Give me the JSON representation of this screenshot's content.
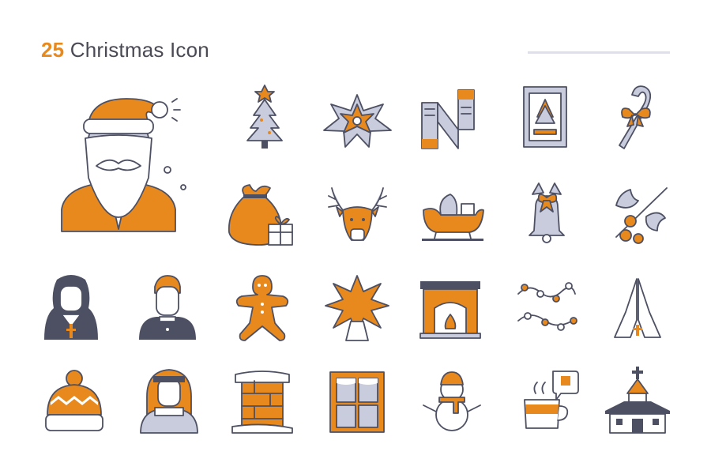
{
  "header": {
    "count": "25",
    "title": "Christmas Icon"
  },
  "icons": [
    "santa-icon",
    "christmas-tree-icon",
    "poinsettia-icon",
    "scarf-icon",
    "christmas-card-icon",
    "candy-cane-icon",
    "gift-sack-icon",
    "reindeer-icon",
    "sleigh-icon",
    "bell-icon",
    "holly-icon",
    "nun-icon",
    "priest-icon",
    "gingerbread-man-icon",
    "star-icon",
    "fireplace-icon",
    "string-lights-icon",
    "praying-hands-icon",
    "winter-hat-icon",
    "girl-in-scarf-icon",
    "chimney-icon",
    "snowy-window-icon",
    "snowman-icon",
    "hot-cocoa-icon",
    "church-icon"
  ]
}
